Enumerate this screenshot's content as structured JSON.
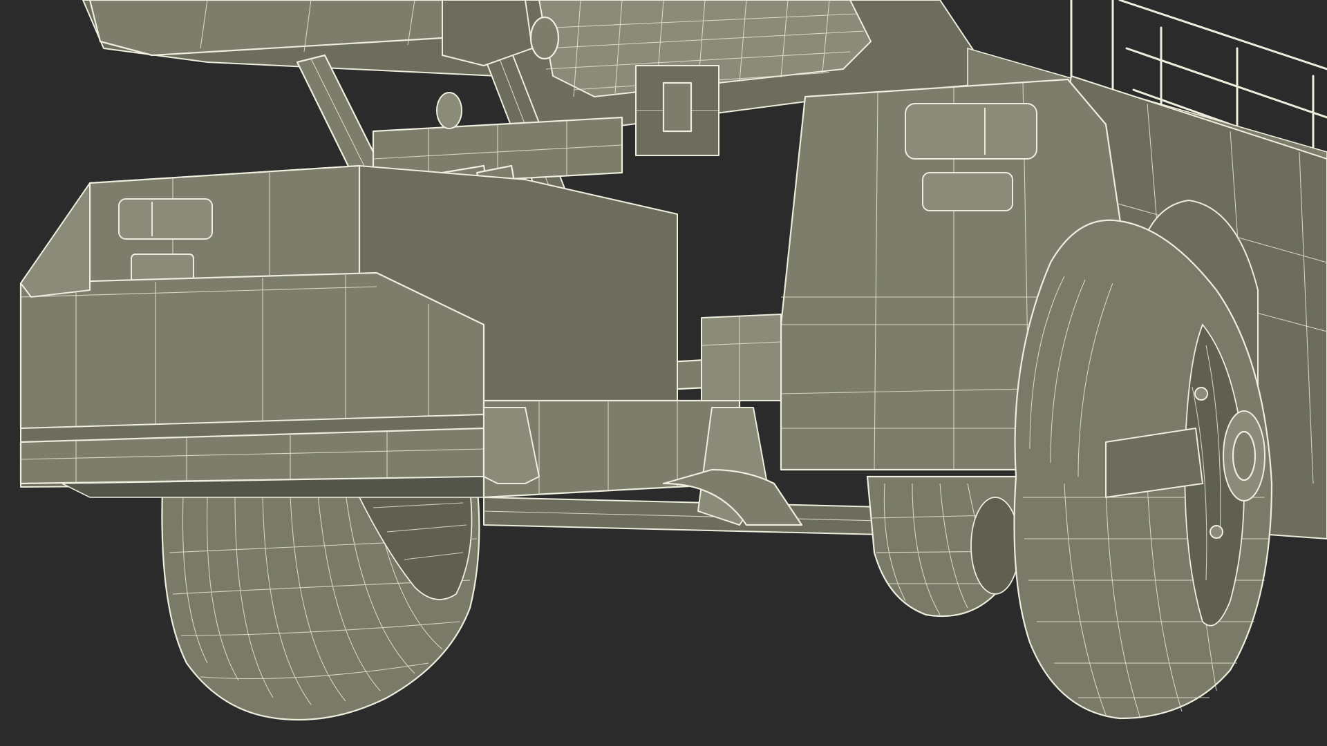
{
  "viewport": {
    "background": "#2b2b2b",
    "model_fill": "#7c7d6b",
    "wire_color": "#efeede"
  },
  "scene": {
    "subject": "wireframe-vehicle-undercarriage",
    "parts": [
      "left-cargo-box",
      "right-cargo-box",
      "scissor-lift-arms",
      "hydraulic-cylinder",
      "left-wheel",
      "right-wheel",
      "rear-wheel",
      "upper-deck",
      "guard-rail"
    ]
  }
}
